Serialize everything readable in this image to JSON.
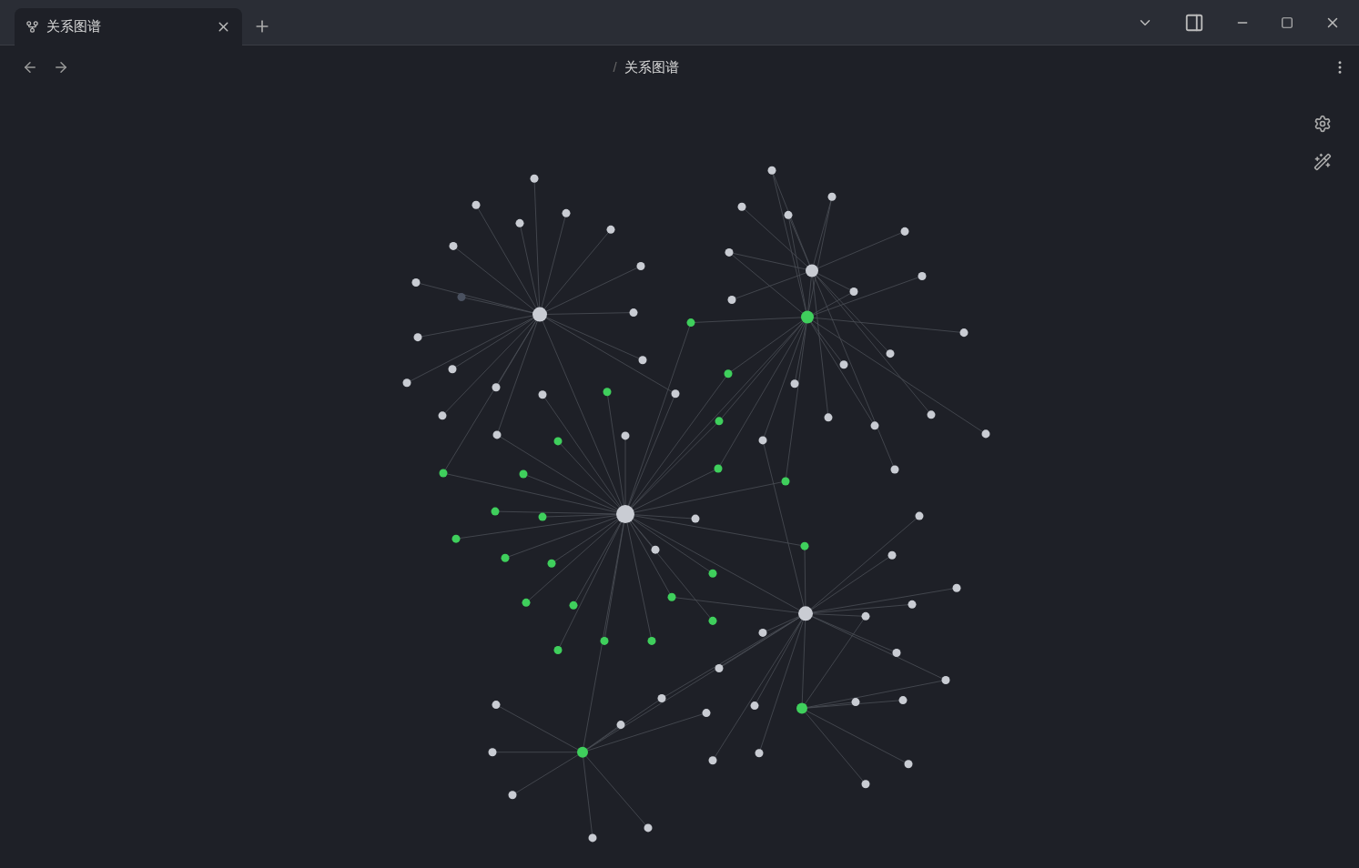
{
  "tabs": [
    {
      "label": "关系图谱",
      "selected": true
    }
  ],
  "breadcrumb": {
    "separator": "/",
    "title": "关系图谱"
  }
}
